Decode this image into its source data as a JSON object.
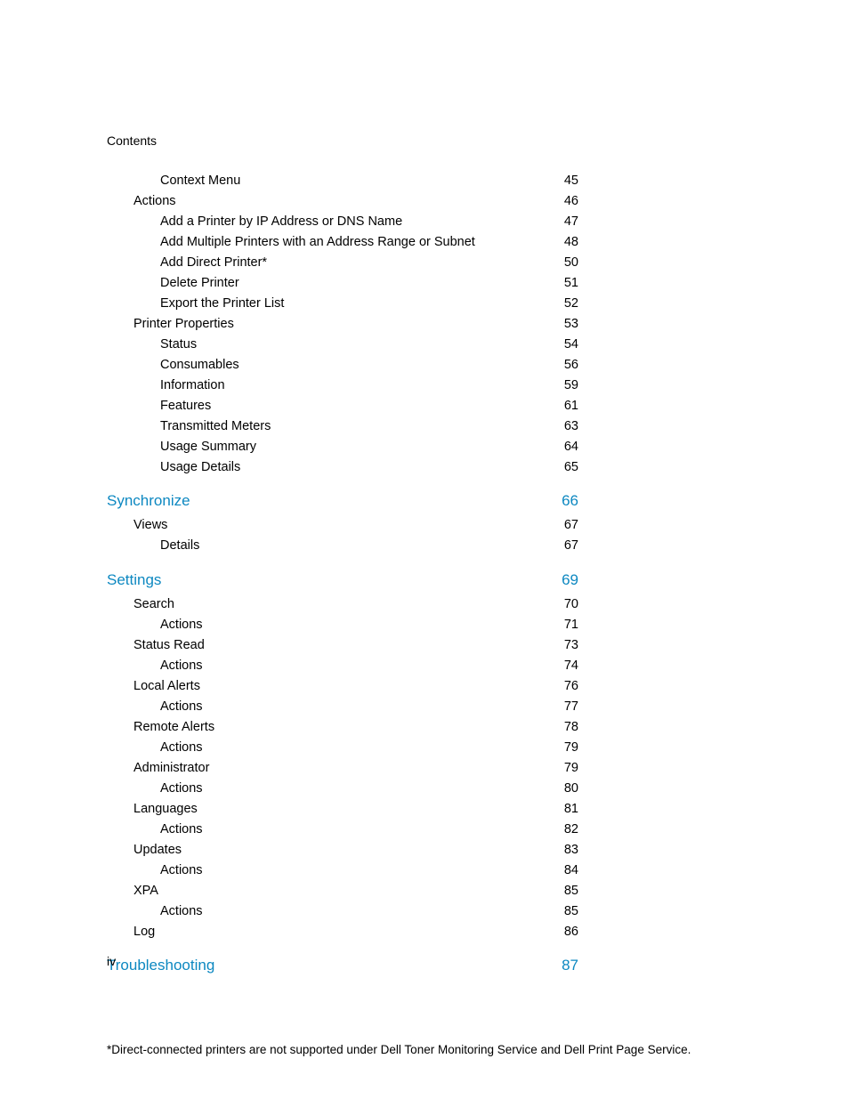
{
  "header": "Contents",
  "page_number": "iv",
  "footnote": "*Direct-connected printers are not supported under Dell Toner Monitoring Service and Dell Print Page Service.",
  "toc": [
    {
      "title": "Context Menu",
      "page": "45",
      "level": 2,
      "section": false
    },
    {
      "title": "Actions ",
      "page": "46",
      "level": 1,
      "section": false
    },
    {
      "title": "Add a Printer by IP Address or DNS Name ",
      "page": "47",
      "level": 2,
      "section": false
    },
    {
      "title": "Add Multiple Printers with an Address Range or Subnet",
      "page": "48",
      "level": 2,
      "section": false
    },
    {
      "title": "Add Direct Printer*",
      "page": "50",
      "level": 2,
      "section": false
    },
    {
      "title": "Delete Printer ",
      "page": "51",
      "level": 2,
      "section": false
    },
    {
      "title": "Export the Printer List ",
      "page": "52",
      "level": 2,
      "section": false
    },
    {
      "title": "Printer Properties ",
      "page": "53",
      "level": 1,
      "section": false
    },
    {
      "title": "Status ",
      "page": "54",
      "level": 2,
      "section": false
    },
    {
      "title": "Consumables ",
      "page": "56",
      "level": 2,
      "section": false
    },
    {
      "title": "Information ",
      "page": "59",
      "level": 2,
      "section": false
    },
    {
      "title": "Features ",
      "page": "61",
      "level": 2,
      "section": false
    },
    {
      "title": "Transmitted Meters ",
      "page": "63",
      "level": 2,
      "section": false
    },
    {
      "title": "Usage Summary ",
      "page": "64",
      "level": 2,
      "section": false
    },
    {
      "title": "Usage Details",
      "page": "65",
      "level": 2,
      "section": false
    },
    {
      "title": "Synchronize ",
      "page": "66",
      "level": 0,
      "section": true
    },
    {
      "title": "Views",
      "page": "67",
      "level": 1,
      "section": false
    },
    {
      "title": "Details ",
      "page": "67",
      "level": 2,
      "section": false
    },
    {
      "title": "Settings ",
      "page": "69",
      "level": 0,
      "section": true
    },
    {
      "title": "Search",
      "page": "70",
      "level": 1,
      "section": false
    },
    {
      "title": "Actions ",
      "page": "71",
      "level": 2,
      "section": false
    },
    {
      "title": "Status Read ",
      "page": "73",
      "level": 1,
      "section": false
    },
    {
      "title": "Actions ",
      "page": "74",
      "level": 2,
      "section": false
    },
    {
      "title": "Local Alerts ",
      "page": "76",
      "level": 1,
      "section": false
    },
    {
      "title": "Actions ",
      "page": "77",
      "level": 2,
      "section": false
    },
    {
      "title": "Remote Alerts ",
      "page": "78",
      "level": 1,
      "section": false
    },
    {
      "title": "Actions ",
      "page": "79",
      "level": 2,
      "section": false
    },
    {
      "title": "Administrator ",
      "page": "79",
      "level": 1,
      "section": false
    },
    {
      "title": "Actions ",
      "page": "80",
      "level": 2,
      "section": false
    },
    {
      "title": "Languages ",
      "page": "81",
      "level": 1,
      "section": false
    },
    {
      "title": "Actions ",
      "page": "82",
      "level": 2,
      "section": false
    },
    {
      "title": "Updates",
      "page": "83",
      "level": 1,
      "section": false
    },
    {
      "title": "Actions ",
      "page": "84",
      "level": 2,
      "section": false
    },
    {
      "title": "XPA ",
      "page": "85",
      "level": 1,
      "section": false
    },
    {
      "title": "Actions ",
      "page": "85",
      "level": 2,
      "section": false
    },
    {
      "title": "Log ",
      "page": "86",
      "level": 1,
      "section": false
    },
    {
      "title": "Troubleshooting ",
      "page": "87",
      "level": 0,
      "section": true
    }
  ]
}
